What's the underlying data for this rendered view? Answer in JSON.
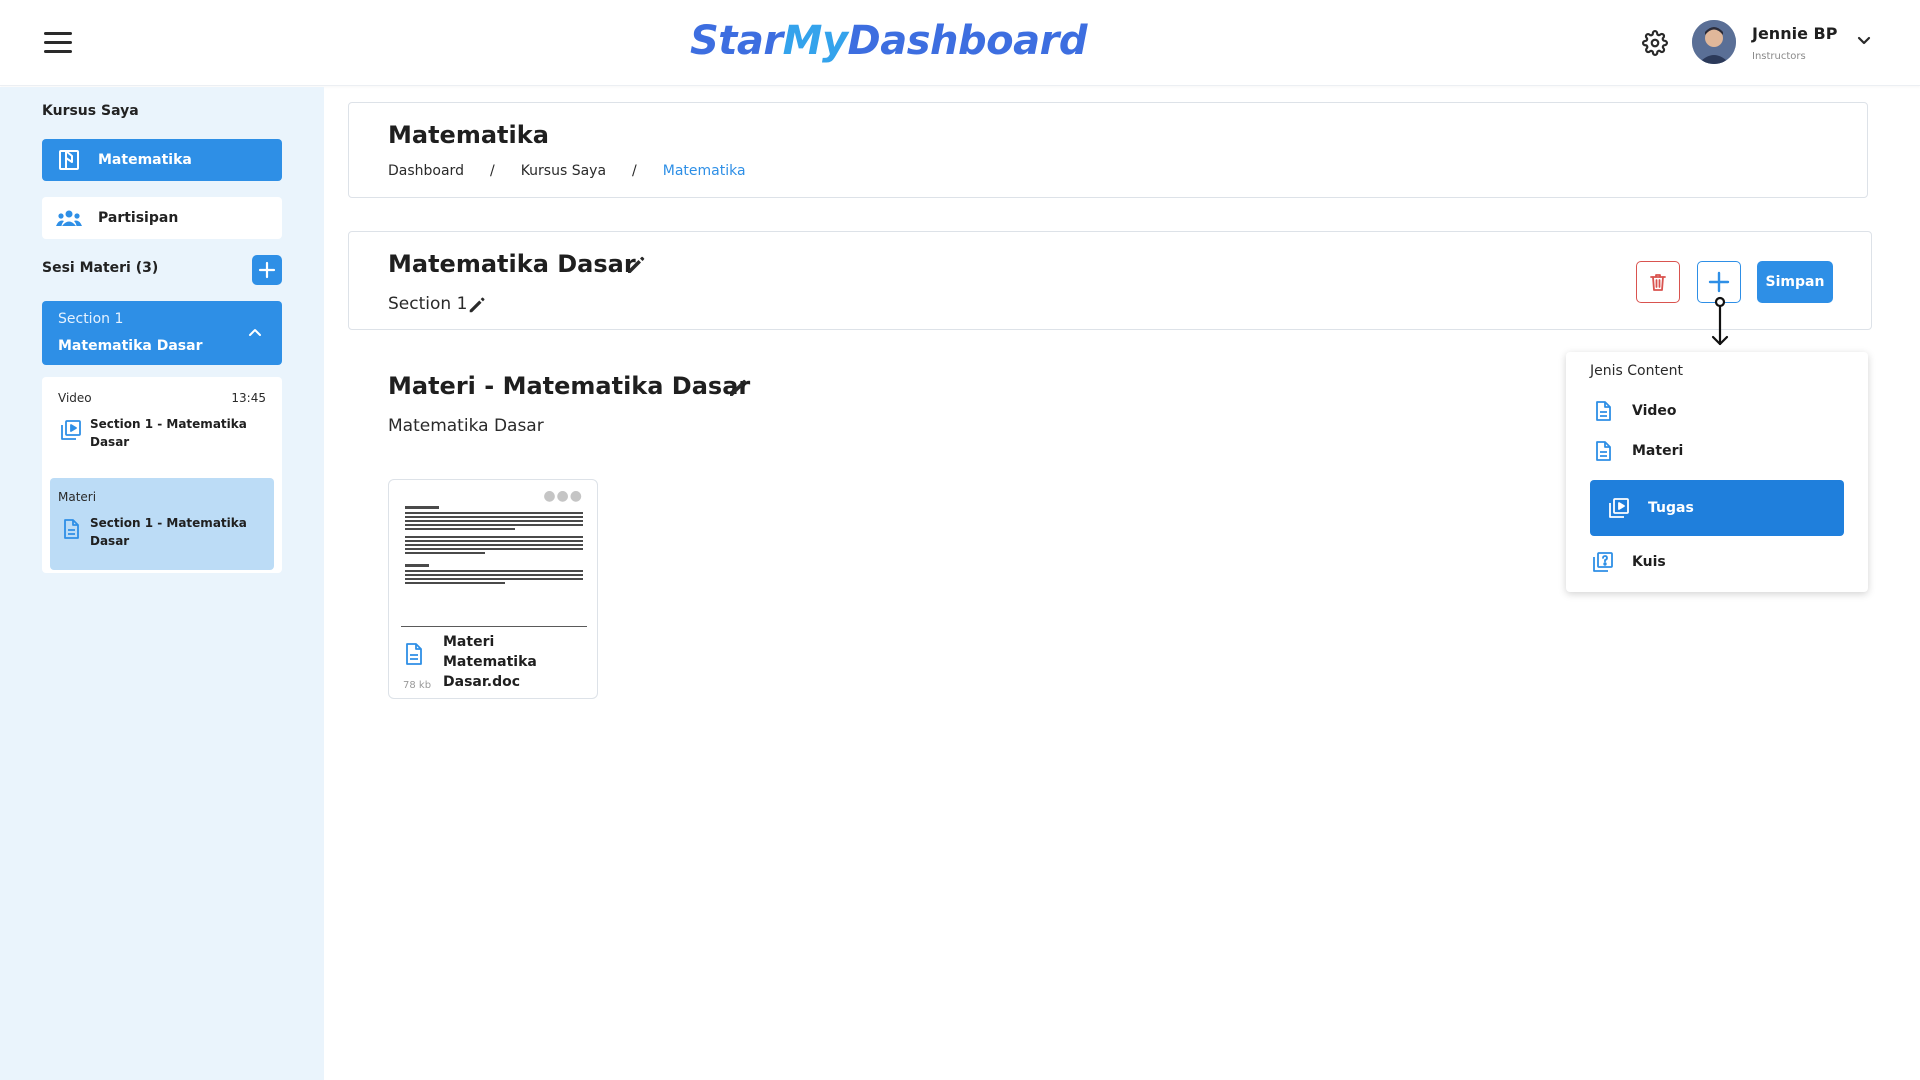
{
  "header": {
    "brand": [
      "Star",
      "My",
      "Dashboard"
    ],
    "user_name": "Jennie BP",
    "user_role": "Instructors",
    "icons": {
      "menu": "hamburger-icon",
      "settings": "gear-icon",
      "account_menu": "chevron-down-icon"
    }
  },
  "sidebar": {
    "title": "Kursus Saya",
    "nav": [
      {
        "label": "Matematika",
        "icon": "book-open-icon",
        "active": true
      },
      {
        "label": "Partisipan",
        "icon": "people-icon",
        "active": false
      }
    ],
    "sessions_title": "Sesi Materi (3)",
    "section": {
      "label": "Section 1",
      "title": "Matematika Dasar",
      "expanded": true
    },
    "contents": [
      {
        "type": "Video",
        "time": "13:45",
        "title": "Section 1 - Matematika Dasar",
        "icon": "video-library-icon",
        "selected": false
      },
      {
        "type": "Materi",
        "time": "",
        "title": "Section 1 - Matematika Dasar",
        "icon": "document-icon",
        "selected": true
      }
    ]
  },
  "page": {
    "title": "Matematika",
    "breadcrumb": [
      "Dashboard",
      "Kursus Saya",
      "Matematika"
    ],
    "breadcrumb_separator": "/"
  },
  "section_card": {
    "title": "Matematika Dasar",
    "subtitle": "Section 1",
    "save_label": "Simpan"
  },
  "materi": {
    "title": "Materi - Matematika Dasar",
    "subtitle": "Matematika Dasar",
    "file": {
      "name": "Materi Matematika Dasar.doc",
      "size": "78 kb"
    }
  },
  "content_type_menu": {
    "heading": "Jenis Content",
    "items": [
      {
        "label": "Video",
        "icon": "document-icon",
        "highlighted": false
      },
      {
        "label": "Materi",
        "icon": "document-icon",
        "highlighted": false
      },
      {
        "label": "Tugas",
        "icon": "video-library-icon",
        "highlighted": true
      },
      {
        "label": "Kuis",
        "icon": "quiz-icon",
        "highlighted": false
      }
    ]
  },
  "colors": {
    "primary": "#2e8fe6",
    "highlight": "#1f7fdc",
    "sidebar_bg": "#eaf4fc",
    "selected_item_bg": "#bcdcf6",
    "danger": "#d9534f",
    "brand_dark": "#3d6ee0",
    "brand_light": "#34a3ec"
  }
}
